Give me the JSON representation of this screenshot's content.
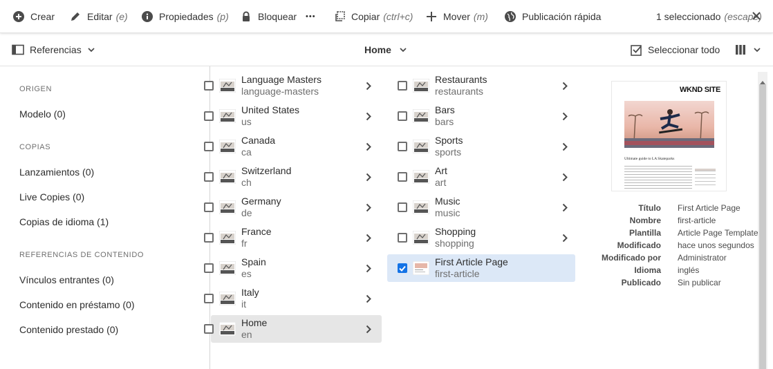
{
  "toolbar": {
    "create": "Crear",
    "edit": "Editar",
    "edit_kb": "(e)",
    "properties": "Propiedades",
    "properties_kb": "(p)",
    "lock": "Bloquear",
    "more": "•••",
    "copy": "Copiar",
    "copy_kb": "(ctrl+c)",
    "move": "Mover",
    "move_kb": "(m)",
    "quick_publish": "Publicación rápida",
    "selection": "1 seleccionado",
    "selection_kb": "(escape)"
  },
  "subbar": {
    "rail_toggle": "Referencias",
    "breadcrumb": "Home",
    "select_all": "Seleccionar todo"
  },
  "rail": {
    "sections": [
      {
        "heading": "ORIGEN",
        "items": [
          "Modelo (0)"
        ]
      },
      {
        "heading": "COPIAS",
        "items": [
          "Lanzamientos (0)",
          "Live Copies (0)",
          "Copias de idioma (1)"
        ]
      },
      {
        "heading": "REFERENCIAS DE CONTENIDO",
        "items": [
          "Vínculos entrantes (0)",
          "Contenido en préstamo (0)",
          "Contenido prestado (0)"
        ]
      }
    ]
  },
  "column1": [
    {
      "title": "Language Masters",
      "name": "language-masters"
    },
    {
      "title": "United States",
      "name": "us"
    },
    {
      "title": "Canada",
      "name": "ca"
    },
    {
      "title": "Switzerland",
      "name": "ch"
    },
    {
      "title": "Germany",
      "name": "de"
    },
    {
      "title": "France",
      "name": "fr"
    },
    {
      "title": "Spain",
      "name": "es"
    },
    {
      "title": "Italy",
      "name": "it"
    },
    {
      "title": "Home",
      "name": "en"
    }
  ],
  "column2": [
    {
      "title": "Restaurants",
      "name": "restaurants"
    },
    {
      "title": "Bars",
      "name": "bars"
    },
    {
      "title": "Sports",
      "name": "sports"
    },
    {
      "title": "Art",
      "name": "art"
    },
    {
      "title": "Music",
      "name": "music"
    },
    {
      "title": "Shopping",
      "name": "shopping"
    },
    {
      "title": "First Article Page",
      "name": "first-article"
    }
  ],
  "preview": {
    "site_name": "WKND SITE",
    "article_headline": "Ultimate guide to LA Skateparks",
    "meta": [
      {
        "key": "Título",
        "value": "First Article Page"
      },
      {
        "key": "Nombre",
        "value": "first-article"
      },
      {
        "key": "Plantilla",
        "value": "Article Page Template"
      },
      {
        "key": "Modificado",
        "value": "hace unos segundos"
      },
      {
        "key": "Modificado por",
        "value": "Administrator"
      },
      {
        "key": "Idioma",
        "value": "inglés"
      },
      {
        "key": "Publicado",
        "value": "Sin publicar"
      }
    ]
  },
  "colors": {
    "accent": "#1473e6",
    "selected_row": "#dce8f7",
    "active_row": "#e6e6e6",
    "scrollbar": "#cacaca"
  }
}
